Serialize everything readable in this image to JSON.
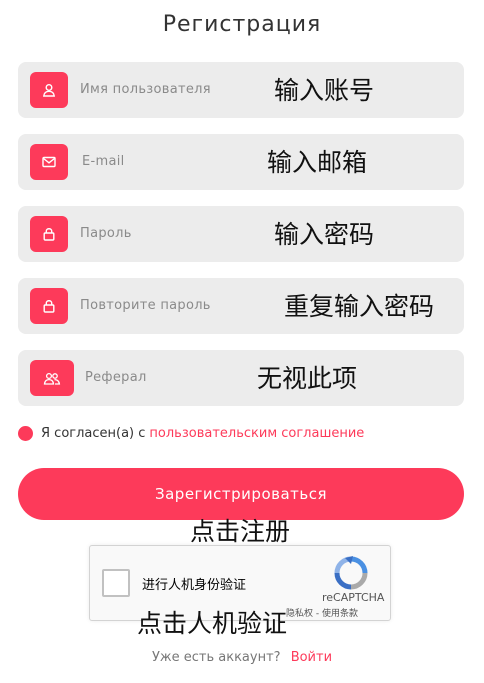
{
  "page": {
    "title": "Регистрация"
  },
  "form": {
    "fields": [
      {
        "placeholder": "Имя пользователя",
        "icon": "user-icon",
        "annotation": "输入账号"
      },
      {
        "placeholder": "E-mail",
        "icon": "mail-icon",
        "annotation": "输入邮箱"
      },
      {
        "placeholder": "Пароль",
        "icon": "lock-icon",
        "annotation": "输入密码"
      },
      {
        "placeholder": "Повторите пароль",
        "icon": "lock-icon",
        "annotation": "重复输入密码"
      },
      {
        "placeholder": "Реферал",
        "icon": "users-icon",
        "annotation": "无视此项"
      }
    ],
    "agree_text": "Я согласен(а) с",
    "agree_link": "пользовательским соглашение",
    "register_label": "Зарегистрироваться",
    "register_annotation": "点击注册"
  },
  "captcha": {
    "label": "进行人机身份验证",
    "brand": "reCAPTCHA",
    "terms": "隐私权 - 使用条款",
    "annotation": "点击人机验证"
  },
  "footer": {
    "question": "Уже есть аккаунт?",
    "login_link": "Войти"
  },
  "colors": {
    "accent": "#fd3a5a",
    "field_bg": "#ececec"
  }
}
